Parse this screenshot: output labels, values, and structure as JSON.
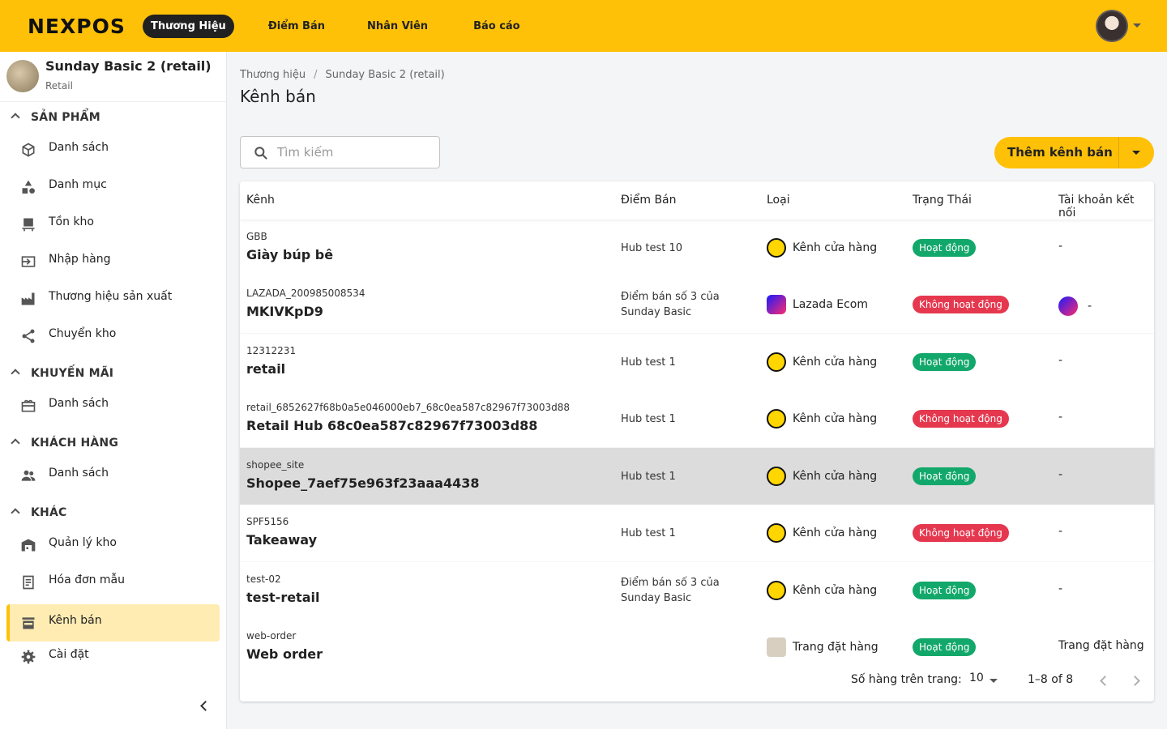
{
  "topbar": {
    "logo": "NEXPOS",
    "nav": [
      "Thương Hiệu",
      "Điểm Bán",
      "Nhân Viên",
      "Báo cáo"
    ]
  },
  "sidebar": {
    "brand_name": "Sunday Basic 2 (retail)",
    "brand_sub": "Retail",
    "sections": [
      {
        "label": "SẢN PHẨM",
        "items": [
          "Danh sách",
          "Danh mục",
          "Tồn kho",
          "Nhập hàng",
          "Thương hiệu sản xuất",
          "Chuyển kho"
        ]
      },
      {
        "label": "KHUYẾN MÃI",
        "items": [
          "Danh sách"
        ]
      },
      {
        "label": "KHÁCH HÀNG",
        "items": [
          "Danh sách"
        ]
      },
      {
        "label": "KHÁC",
        "items": [
          "Quản lý kho",
          "Hóa đơn mẫu",
          "Kênh bán",
          "Cài đặt"
        ]
      }
    ]
  },
  "breadcrumb": [
    "Thương hiệu",
    "Sunday Basic 2 (retail)"
  ],
  "page_title": "Kênh bán",
  "search": {
    "placeholder": "Tìm kiếm",
    "value": ""
  },
  "add_button": "Thêm kênh bán",
  "table": {
    "headers": [
      "Kênh",
      "Điểm Bán",
      "Loại",
      "Trạng Thái",
      "Tài khoản kết nối"
    ],
    "rows": [
      {
        "code": "GBB",
        "name": "Giày búp bê",
        "store": "Hub test 10",
        "type": "Kênh cửa hàng",
        "type_icon": "store-icon",
        "status": "Hoạt động",
        "status_kind": "on",
        "account": "-"
      },
      {
        "code": "LAZADA_200985008534",
        "name": "MKIVKpD9",
        "store": "Điểm bán số 3 của Sunday Basic",
        "type": "Lazada Ecom",
        "type_icon": "lazada-icon",
        "status": "Không hoạt động",
        "status_kind": "off",
        "account": "-"
      },
      {
        "code": "12312231",
        "name": "retail",
        "store": "Hub test 1",
        "type": "Kênh cửa hàng",
        "type_icon": "store-icon",
        "status": "Hoạt động",
        "status_kind": "on",
        "account": "-"
      },
      {
        "code": "retail_6852627f68b0a5e046000eb7_68c0ea587c82967f73003d88",
        "name": "Retail Hub 68c0ea587c82967f73003d88",
        "store": "Hub test 1",
        "type": "Kênh cửa hàng",
        "type_icon": "store-icon",
        "status": "Không hoạt động",
        "status_kind": "off",
        "account": "-"
      },
      {
        "code": "shopee_site",
        "name": "Shopee_7aef75e963f23aaa4438",
        "store": "Hub test 1",
        "type": "Kênh cửa hàng",
        "type_icon": "store-icon",
        "status": "Hoạt động",
        "status_kind": "on",
        "account": "-"
      },
      {
        "code": "SPF5156",
        "name": "Takeaway",
        "store": "Hub test 1",
        "type": "Kênh cửa hàng",
        "type_icon": "store-icon",
        "status": "Không hoạt động",
        "status_kind": "off",
        "account": "-"
      },
      {
        "code": "test-02",
        "name": "test-retail",
        "store": "Điểm bán số 3 của Sunday Basic",
        "type": "Kênh cửa hàng",
        "type_icon": "store-icon",
        "status": "Hoạt động",
        "status_kind": "on",
        "account": "-"
      },
      {
        "code": "web-order",
        "name": "Web order",
        "store": "",
        "type": "Trang đặt hàng",
        "type_icon": "web-order-icon",
        "status": "Hoạt động",
        "status_kind": "on",
        "account": "Trang đặt hàng"
      }
    ]
  },
  "pagination": {
    "rows_per_page_label": "Số hàng trên trang:",
    "rows_per_page": "10",
    "range": "1–8 of 8"
  },
  "colors": {
    "brand_yellow": "#ffc107",
    "active_bg": "#ffecb3",
    "status_on": "#13a86b",
    "status_off": "#e5384f"
  }
}
